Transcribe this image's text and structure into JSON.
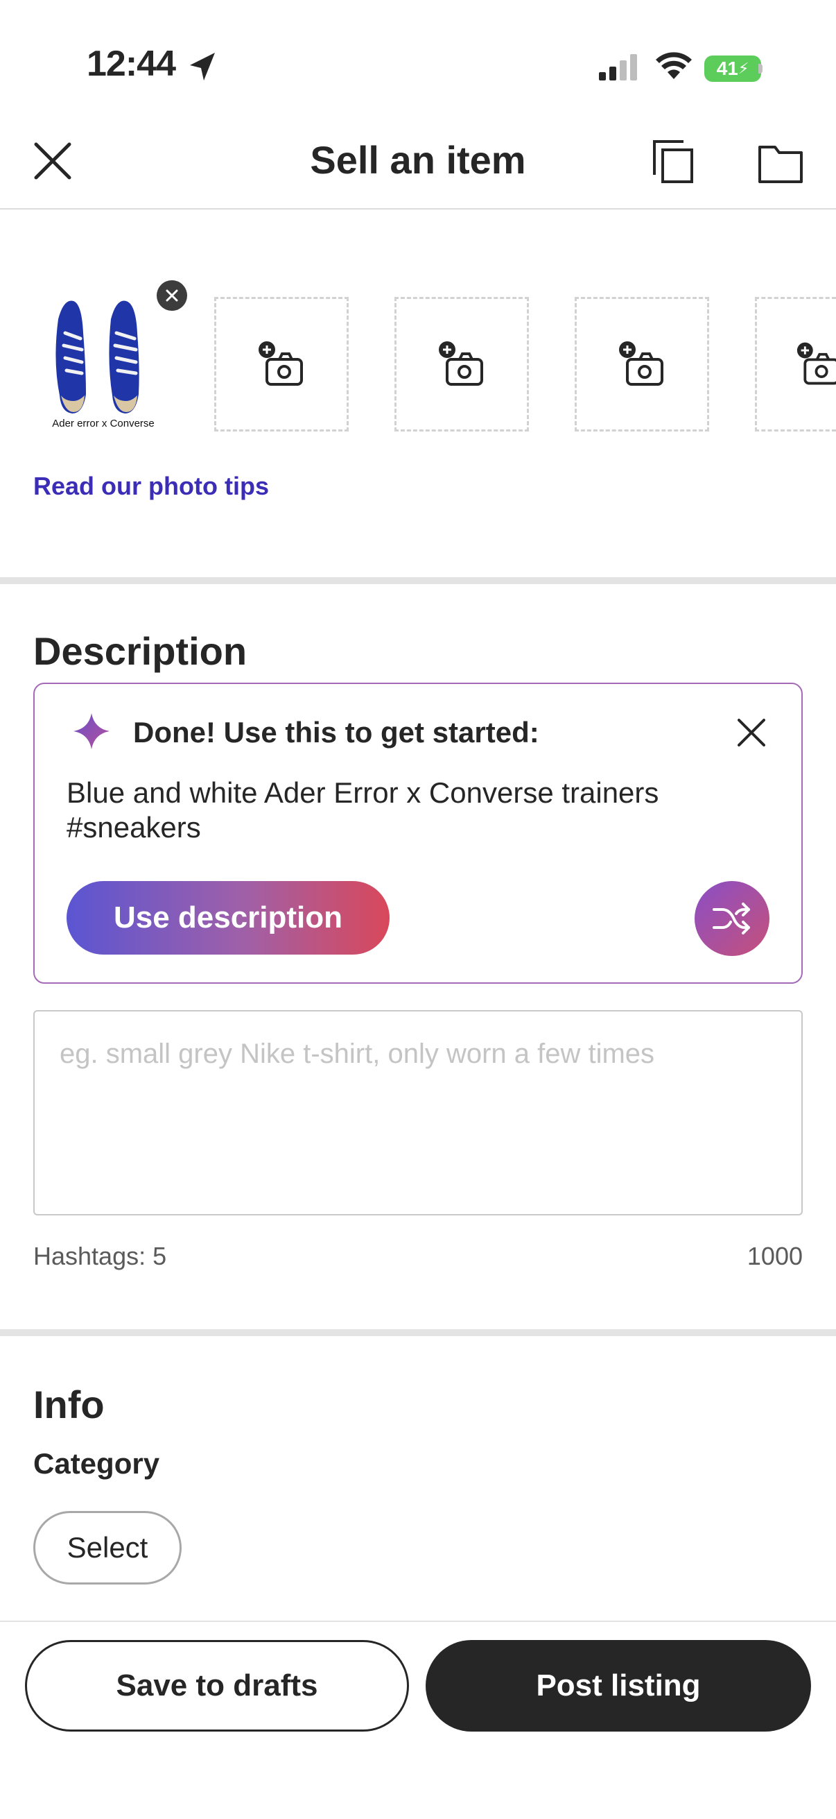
{
  "status_bar": {
    "time": "12:44",
    "battery": "41"
  },
  "header": {
    "title": "Sell an item"
  },
  "photos": {
    "thumb_caption": "Ader error x Converse",
    "tips_link": "Read our photo tips"
  },
  "description": {
    "title": "Description",
    "ai_card": {
      "title": "Done! Use this to get started:",
      "suggestion": "Blue and white Ader Error x Converse trainers #sneakers",
      "use_button": "Use description"
    },
    "input": {
      "placeholder": "eg. small grey Nike t-shirt, only worn a few times",
      "value": ""
    },
    "hashtags": "Hashtags: 5",
    "char_remaining": "1000"
  },
  "info": {
    "title": "Info",
    "category_label": "Category",
    "select_label": "Select"
  },
  "footer": {
    "save_drafts": "Save to drafts",
    "post_listing": "Post listing"
  },
  "colors": {
    "accent_link": "#3b2db5",
    "card_border": "#a46ab8",
    "gradient_start": "#5b55d2",
    "gradient_end": "#d9485a",
    "primary_dark": "#262626",
    "battery_green": "#5ccc5b"
  },
  "icons": {
    "close": "close-icon",
    "copy": "copy-icon",
    "folder": "folder-icon",
    "add_photo": "add-photo-icon",
    "sparkle": "sparkle-icon",
    "shuffle": "shuffle-icon"
  }
}
